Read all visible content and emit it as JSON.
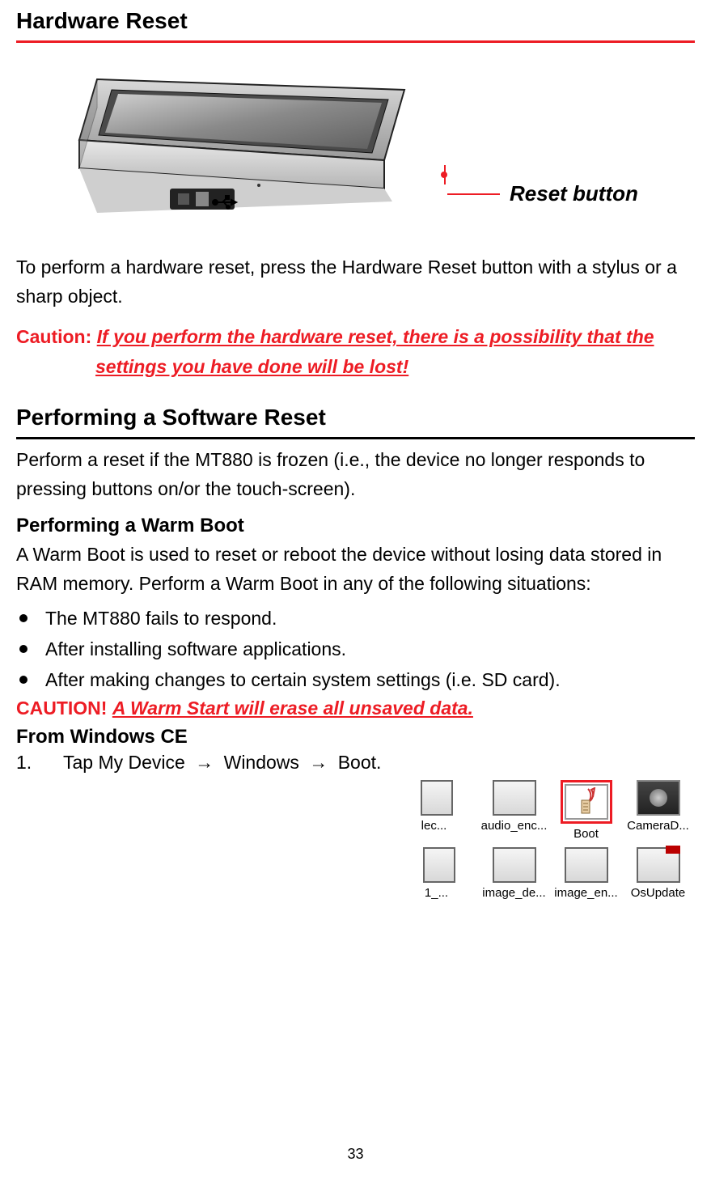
{
  "page_number": "33",
  "headings": {
    "h1": "Hardware Reset",
    "h2": "Performing a Software Reset",
    "h3_warm": "Performing a Warm Boot",
    "h3_winCE": "From Windows CE"
  },
  "figure": {
    "reset_label": "Reset button"
  },
  "paras": {
    "hw_reset_intro": "To perform a hardware reset, press the Hardware Reset button with a stylus or a sharp object.",
    "sw_reset_intro": "Perform a reset if the MT880 is frozen (i.e., the device no longer responds to pressing buttons on/or the touch-screen).",
    "warm_intro": "A Warm Boot is used to reset or reboot the device without losing data stored in RAM memory. Perform a Warm Boot in any of the following situations:"
  },
  "caution1": {
    "label": "Caution: ",
    "line1": "If you perform the hardware reset, there is a possibility that the",
    "line2": "settings you have done will be lost!"
  },
  "bullets": [
    "The MT880 fails to respond.",
    "After installing software applications.",
    "After making changes to certain system settings (i.e. SD card)."
  ],
  "caution2": {
    "label": "CAUTION! ",
    "body": "A Warm Start will erase all unsaved data."
  },
  "step1": {
    "num": "1.",
    "text_pre": "Tap My Device ",
    "arrow": "→",
    "text_mid": " Windows ",
    "text_post": " Boot."
  },
  "screenshot": {
    "row1": [
      {
        "label": "lec..."
      },
      {
        "label": "audio_enc..."
      },
      {
        "label": "Boot"
      },
      {
        "label": "CameraD..."
      }
    ],
    "row2": [
      {
        "label": "1_..."
      },
      {
        "label": "image_de..."
      },
      {
        "label": "image_en..."
      },
      {
        "label": "OsUpdate"
      }
    ]
  }
}
